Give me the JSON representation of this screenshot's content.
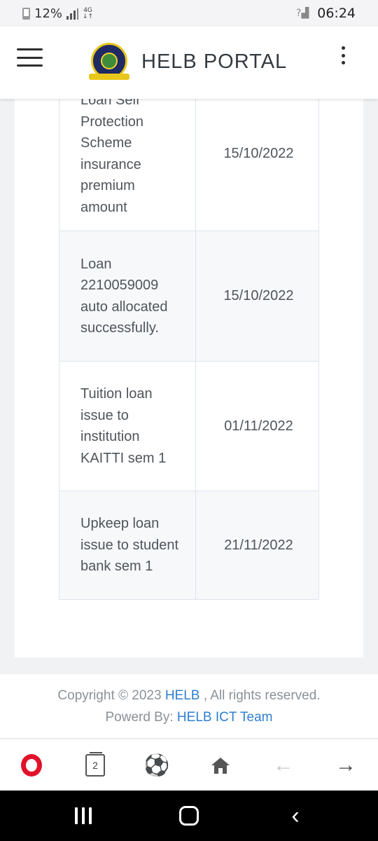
{
  "status_bar": {
    "battery": "12%",
    "network": "4G",
    "time": "06:24"
  },
  "header": {
    "title": "HELB PORTAL",
    "menu_icon": "hamburger-icon",
    "more_icon": "more-vertical-icon"
  },
  "table": {
    "rows": [
      {
        "description": "Loan Self Protection Scheme insurance premium amount",
        "date": "15/10/2022"
      },
      {
        "description": "Loan 2210059009 auto allocated successfully.",
        "date": "15/10/2022"
      },
      {
        "description": "Tuition loan issue to institution KAITTI sem 1",
        "date": "01/11/2022"
      },
      {
        "description": "Upkeep loan issue to student bank sem 1",
        "date": "21/11/2022"
      }
    ]
  },
  "footer": {
    "copyright_prefix": "Copyright © 2023",
    "brand_link": "HELB",
    "rights": ", All rights reserved.",
    "powered_prefix": "Powerd By:",
    "team_link": "HELB ICT Team"
  },
  "browser_toolbar": {
    "tab_count": "2",
    "icons": [
      "opera-icon",
      "tabs-icon",
      "soccer-ball-icon",
      "home-icon",
      "back-arrow-icon",
      "forward-arrow-icon"
    ]
  },
  "colors": {
    "link": "#2f7fd0",
    "opera_red": "#e0132a",
    "logo_navy": "#1f2a64",
    "logo_gold": "#e9c71a"
  }
}
